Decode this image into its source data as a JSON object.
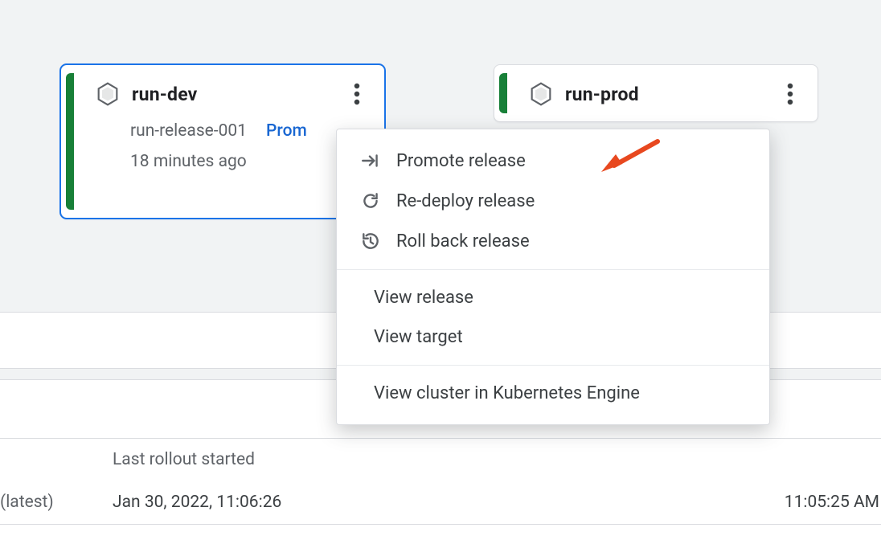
{
  "cards": {
    "dev": {
      "title": "run-dev",
      "release": "run-release-001",
      "promote_link": "Prom",
      "age": "18 minutes ago"
    },
    "prod": {
      "title": "run-prod"
    }
  },
  "menu": {
    "promote": "Promote release",
    "redeploy": "Re-deploy release",
    "rollback": "Roll back release",
    "view_release": "View release",
    "view_target": "View target",
    "view_cluster": "View cluster in Kubernetes Engine"
  },
  "table": {
    "header_last_started": "Last rollout started",
    "row1": {
      "suffix": "(latest)",
      "started": "Jan 30, 2022, 11:06:26",
      "right_time": "11:05:25 AM"
    }
  }
}
